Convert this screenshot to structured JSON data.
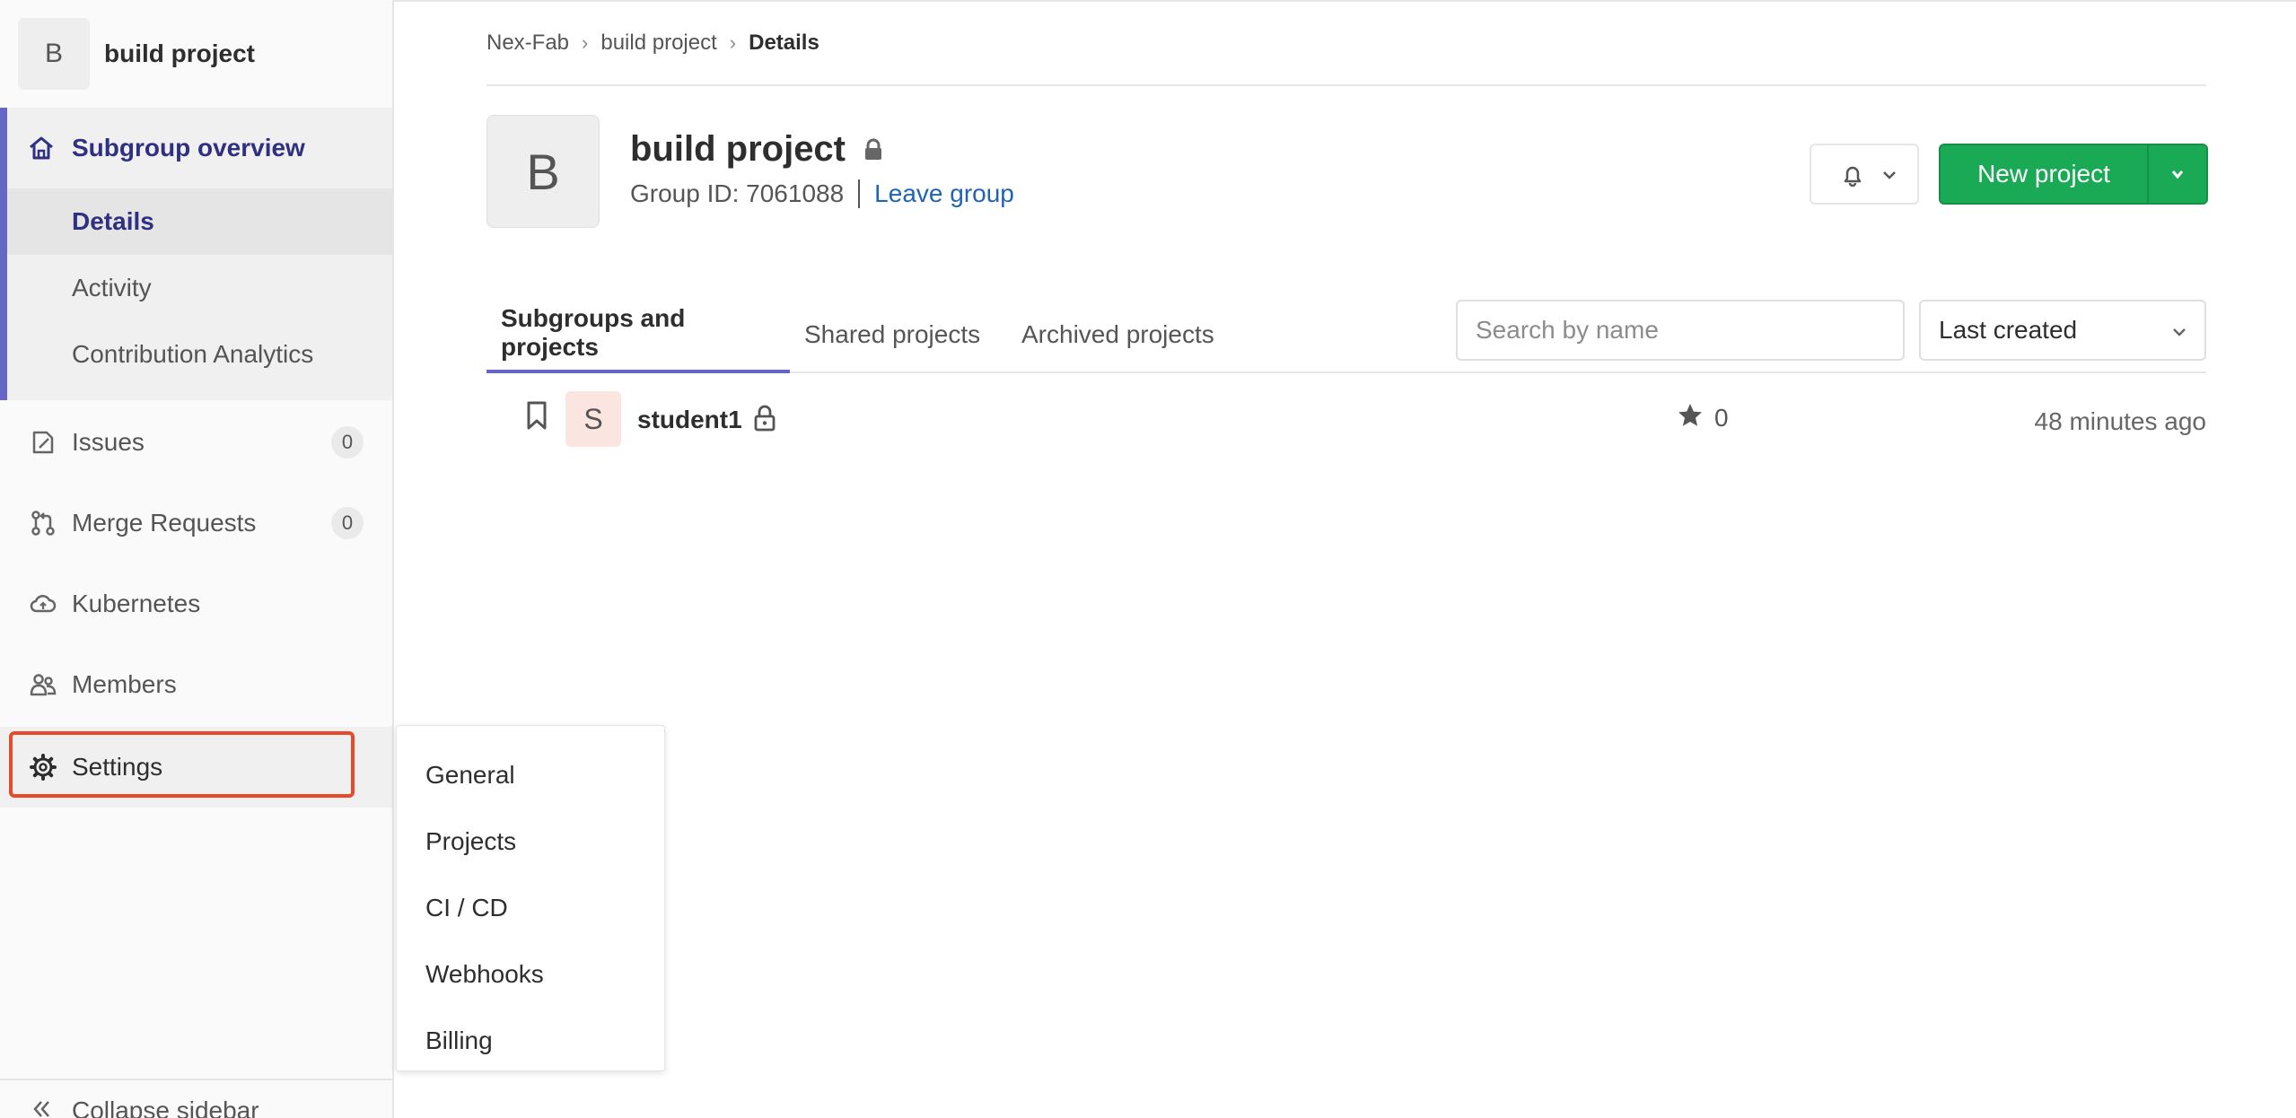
{
  "sidebar": {
    "context_avatar": "B",
    "context_title": "build project",
    "overview_label": "Subgroup overview",
    "sub_items": [
      "Details",
      "Activity",
      "Contribution Analytics"
    ],
    "issues_label": "Issues",
    "issues_count": "0",
    "merge_requests_label": "Merge Requests",
    "merge_requests_count": "0",
    "kubernetes_label": "Kubernetes",
    "members_label": "Members",
    "settings_label": "Settings",
    "collapse_label": "Collapse sidebar"
  },
  "settings_flyout": {
    "items": [
      "General",
      "Projects",
      "CI / CD",
      "Webhooks",
      "Billing"
    ]
  },
  "breadcrumb": {
    "items": [
      "Nex-Fab",
      "build project"
    ],
    "current": "Details"
  },
  "group": {
    "avatar": "B",
    "title": "build project",
    "id_text": "Group ID: 7061088",
    "leave_link": "Leave group"
  },
  "actions": {
    "new_project_label": "New project"
  },
  "tabs": [
    "Subgroups and projects",
    "Shared projects",
    "Archived projects"
  ],
  "filter": {
    "search_placeholder": "Search by name",
    "sort_selected": "Last created"
  },
  "projects": [
    {
      "avatar": "S",
      "name": "student1",
      "stars": "0",
      "updated": "48 minutes ago"
    }
  ],
  "colors": {
    "accent": "#6666c4",
    "nav_active_text": "#303083",
    "primary_button": "#1aaa55",
    "link": "#1f63b5",
    "highlight_box": "#e8492a"
  }
}
